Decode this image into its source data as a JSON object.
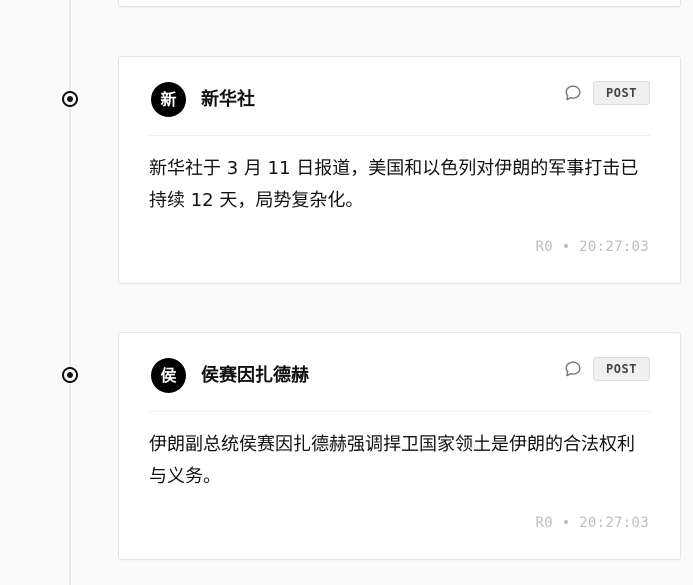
{
  "posts": [
    {
      "avatar_char": "新",
      "source": "新华社",
      "badge": "POST",
      "text": "新华社于 3 月 11 日报道，美国和以色列对伊朗的军事打击已持续 12 天，局势复杂化。",
      "meta": "R0 • 20:27:03"
    },
    {
      "avatar_char": "侯",
      "source": "侯赛因扎德赫",
      "badge": "POST",
      "text": "伊朗副总统侯赛因扎德赫强调捍卫国家领土是伊朗的合法权利与义务。",
      "meta": "R0 • 20:27:03"
    }
  ],
  "icons": {
    "comment": "comment-bubble-icon",
    "timeline_marker": "timeline-dot-icon"
  },
  "colors": {
    "background": "#fafafa",
    "card": "#ffffff",
    "avatar": "#000000",
    "badge_bg": "#f0f0f0",
    "meta_text": "#bdbdbd"
  }
}
